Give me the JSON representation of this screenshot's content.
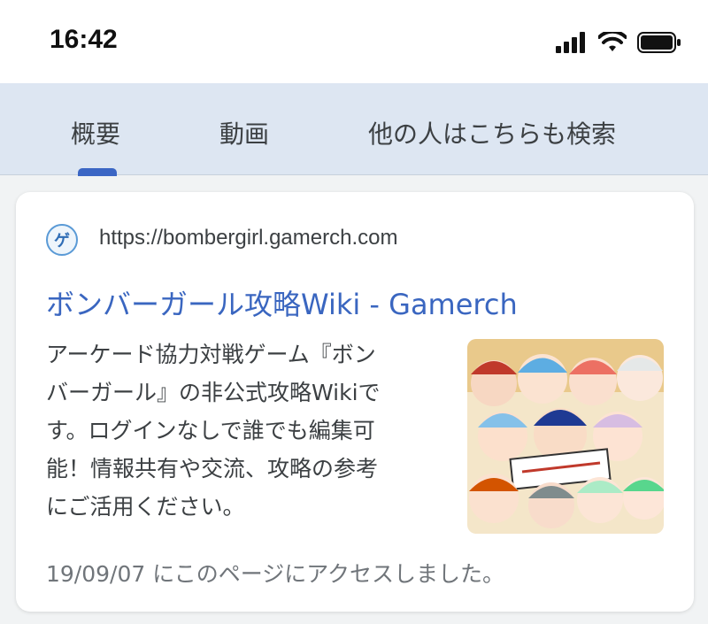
{
  "status": {
    "time": "16:42",
    "icons": [
      "cellular-signal-icon",
      "wifi-icon",
      "battery-icon"
    ]
  },
  "tabs": [
    {
      "label": "概要",
      "selected": true
    },
    {
      "label": "動画",
      "selected": false
    },
    {
      "label": "他の人はこちらも検索",
      "selected": false
    }
  ],
  "result": {
    "favicon_text": "ゲ",
    "url": "https://bombergirl.gamerch.com",
    "title": "ボンバーガール攻略Wiki - Gamerch",
    "snippet_lines": [
      "アーケード協力対戦ゲーム『ボン",
      "バーガール』の非公式攻略Wikiで",
      "す。ログインなしで誰でも編集可",
      "能！情報共有や交流、攻略の参考",
      "にご活用ください。"
    ],
    "visited": "19/09/07 にこのページにアクセスしました。",
    "thumbnail_alt": "ボンバーガール キャラクター集合イラスト"
  },
  "colors": {
    "tab_bar_bg": "#dde6f2",
    "indicator": "#3b66c4",
    "title_link": "#3a66c0"
  }
}
